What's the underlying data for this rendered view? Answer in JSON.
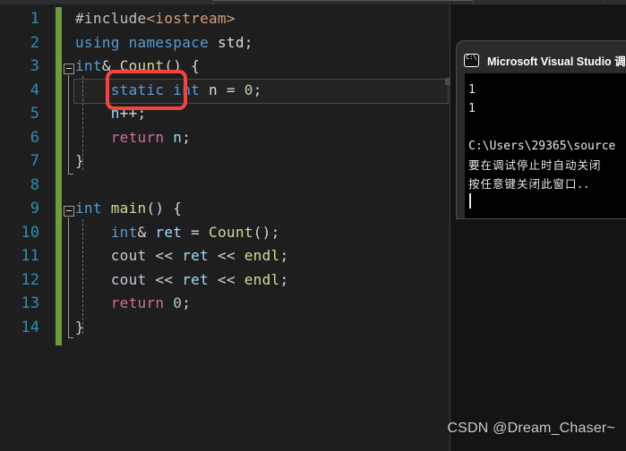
{
  "editor": {
    "language": "cpp",
    "theme_background": "#1e1e1e",
    "gutter": {
      "line_numbers": [
        "1",
        "2",
        "3",
        "4",
        "5",
        "6",
        "7",
        "8",
        "9",
        "10",
        "11",
        "12",
        "13",
        "14"
      ],
      "line_number_color": "#2b91af",
      "change_bar_color": "#6a9f3a"
    },
    "lines": [
      {
        "n": "1",
        "tokens": [
          {
            "t": "#include",
            "c": "pp"
          },
          {
            "t": "<iostream>",
            "c": "hdr"
          }
        ]
      },
      {
        "n": "2",
        "tokens": [
          {
            "t": "using",
            "c": "kw"
          },
          {
            "t": " ",
            "c": "op"
          },
          {
            "t": "namespace",
            "c": "kw"
          },
          {
            "t": " ",
            "c": "op"
          },
          {
            "t": "std",
            "c": "id"
          },
          {
            "t": ";",
            "c": "op"
          }
        ]
      },
      {
        "n": "3",
        "tokens": [
          {
            "t": "int",
            "c": "kw"
          },
          {
            "t": "& ",
            "c": "op"
          },
          {
            "t": "Count",
            "c": "fn"
          },
          {
            "t": "() {",
            "c": "op"
          }
        ]
      },
      {
        "n": "4",
        "tokens": [
          {
            "t": "    ",
            "c": "op"
          },
          {
            "t": "static",
            "c": "kw"
          },
          {
            "t": " ",
            "c": "op"
          },
          {
            "t": "int",
            "c": "kw"
          },
          {
            "t": " ",
            "c": "op"
          },
          {
            "t": "n",
            "c": "id"
          },
          {
            "t": " = ",
            "c": "op"
          },
          {
            "t": "0",
            "c": "num"
          },
          {
            "t": ";",
            "c": "op"
          }
        ]
      },
      {
        "n": "5",
        "tokens": [
          {
            "t": "    ",
            "c": "op"
          },
          {
            "t": "n",
            "c": "var"
          },
          {
            "t": "++;",
            "c": "op"
          }
        ]
      },
      {
        "n": "6",
        "tokens": [
          {
            "t": "    ",
            "c": "op"
          },
          {
            "t": "return",
            "c": "ret"
          },
          {
            "t": " ",
            "c": "op"
          },
          {
            "t": "n",
            "c": "var"
          },
          {
            "t": ";",
            "c": "op"
          }
        ]
      },
      {
        "n": "7",
        "tokens": [
          {
            "t": "}",
            "c": "op"
          }
        ]
      },
      {
        "n": "8",
        "tokens": []
      },
      {
        "n": "9",
        "tokens": [
          {
            "t": "int",
            "c": "kw"
          },
          {
            "t": " ",
            "c": "op"
          },
          {
            "t": "main",
            "c": "fn"
          },
          {
            "t": "() {",
            "c": "op"
          }
        ]
      },
      {
        "n": "10",
        "tokens": [
          {
            "t": "    ",
            "c": "op"
          },
          {
            "t": "int",
            "c": "kw"
          },
          {
            "t": "& ",
            "c": "op"
          },
          {
            "t": "ret",
            "c": "var"
          },
          {
            "t": " = ",
            "c": "op"
          },
          {
            "t": "Count",
            "c": "fn"
          },
          {
            "t": "();",
            "c": "op"
          }
        ]
      },
      {
        "n": "11",
        "tokens": [
          {
            "t": "    ",
            "c": "op"
          },
          {
            "t": "cout",
            "c": "obj"
          },
          {
            "t": " << ",
            "c": "op"
          },
          {
            "t": "ret",
            "c": "var"
          },
          {
            "t": " << ",
            "c": "op"
          },
          {
            "t": "endl",
            "c": "endl"
          },
          {
            "t": ";",
            "c": "op"
          }
        ]
      },
      {
        "n": "12",
        "tokens": [
          {
            "t": "    ",
            "c": "op"
          },
          {
            "t": "cout",
            "c": "obj"
          },
          {
            "t": " << ",
            "c": "op"
          },
          {
            "t": "ret",
            "c": "var"
          },
          {
            "t": " << ",
            "c": "op"
          },
          {
            "t": "endl",
            "c": "endl"
          },
          {
            "t": ";",
            "c": "op"
          }
        ]
      },
      {
        "n": "13",
        "tokens": [
          {
            "t": "    ",
            "c": "op"
          },
          {
            "t": "return",
            "c": "ret"
          },
          {
            "t": " ",
            "c": "op"
          },
          {
            "t": "0",
            "c": "num"
          },
          {
            "t": ";",
            "c": "op"
          }
        ]
      },
      {
        "n": "14",
        "tokens": [
          {
            "t": "}",
            "c": "op"
          }
        ]
      }
    ],
    "current_line": "4",
    "annotation": {
      "shape": "rounded-rectangle",
      "color": "#f2453d",
      "target_text": "static"
    }
  },
  "console": {
    "icon": "console-window-icon",
    "title": "Microsoft Visual Studio 调试",
    "output": [
      "1",
      "1",
      "",
      "C:\\Users\\29365\\source",
      "要在调试停止时自动关闭",
      "按任意键关闭此窗口．．"
    ]
  },
  "watermark": {
    "text": "CSDN @Dream_Chaser~"
  }
}
